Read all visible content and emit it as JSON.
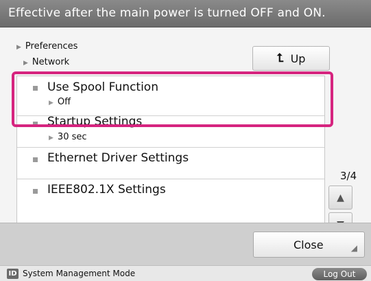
{
  "header": {
    "title": "Effective after the main power is turned OFF and ON."
  },
  "breadcrumb": {
    "level1": "Preferences",
    "level2": "Network"
  },
  "nav": {
    "up_label": "Up"
  },
  "list": {
    "items": [
      {
        "label": "Use Spool Function",
        "value": "Off"
      },
      {
        "label": "Startup Settings",
        "value": "30 sec"
      },
      {
        "label": "Ethernet Driver Settings",
        "value": ""
      },
      {
        "label": "IEEE802.1X Settings",
        "value": ""
      }
    ]
  },
  "pager": {
    "page": "3/4",
    "up_icon": "triangle-up",
    "down_icon": "triangle-down"
  },
  "footer": {
    "close_label": "Close"
  },
  "status": {
    "mode_icon": "ID",
    "mode_text": "System Management Mode",
    "logout_label": "Log Out"
  },
  "colors": {
    "highlight": "#d6247f",
    "header_bg": "#7a7a7a"
  }
}
